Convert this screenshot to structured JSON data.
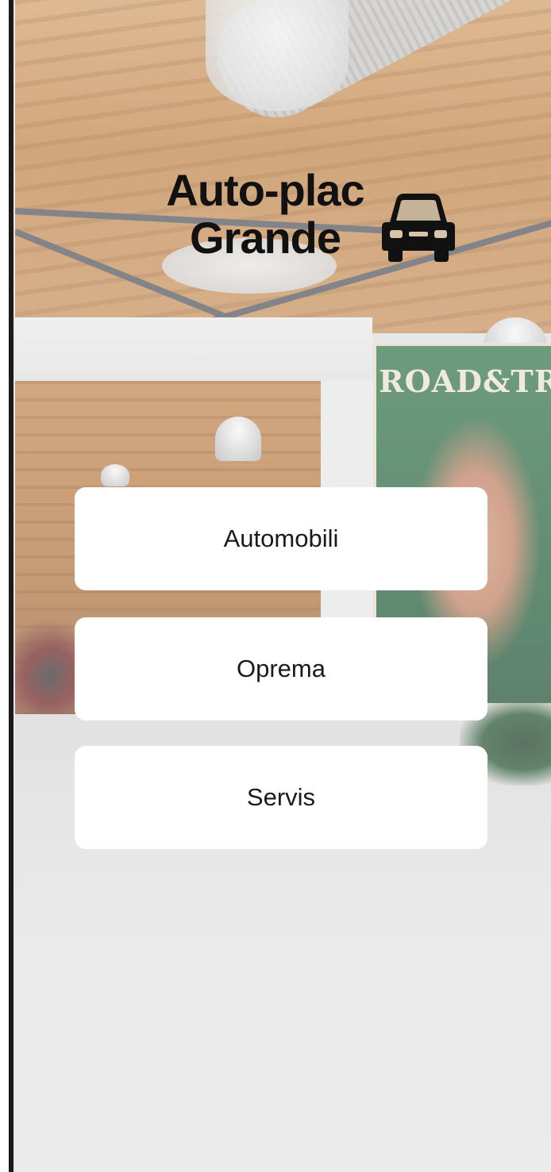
{
  "brand": {
    "title_line1": "Auto-plac",
    "title_line2": "Grande",
    "logo_icon": "car-icon"
  },
  "background": {
    "poster_text": "ROAD&TRACK"
  },
  "menu": {
    "items": [
      {
        "label": "Automobili"
      },
      {
        "label": "Oprema"
      },
      {
        "label": "Servis"
      }
    ]
  },
  "colors": {
    "button_bg": "#ffffff",
    "title_text": "#111111",
    "button_text": "#1a1a1a"
  }
}
